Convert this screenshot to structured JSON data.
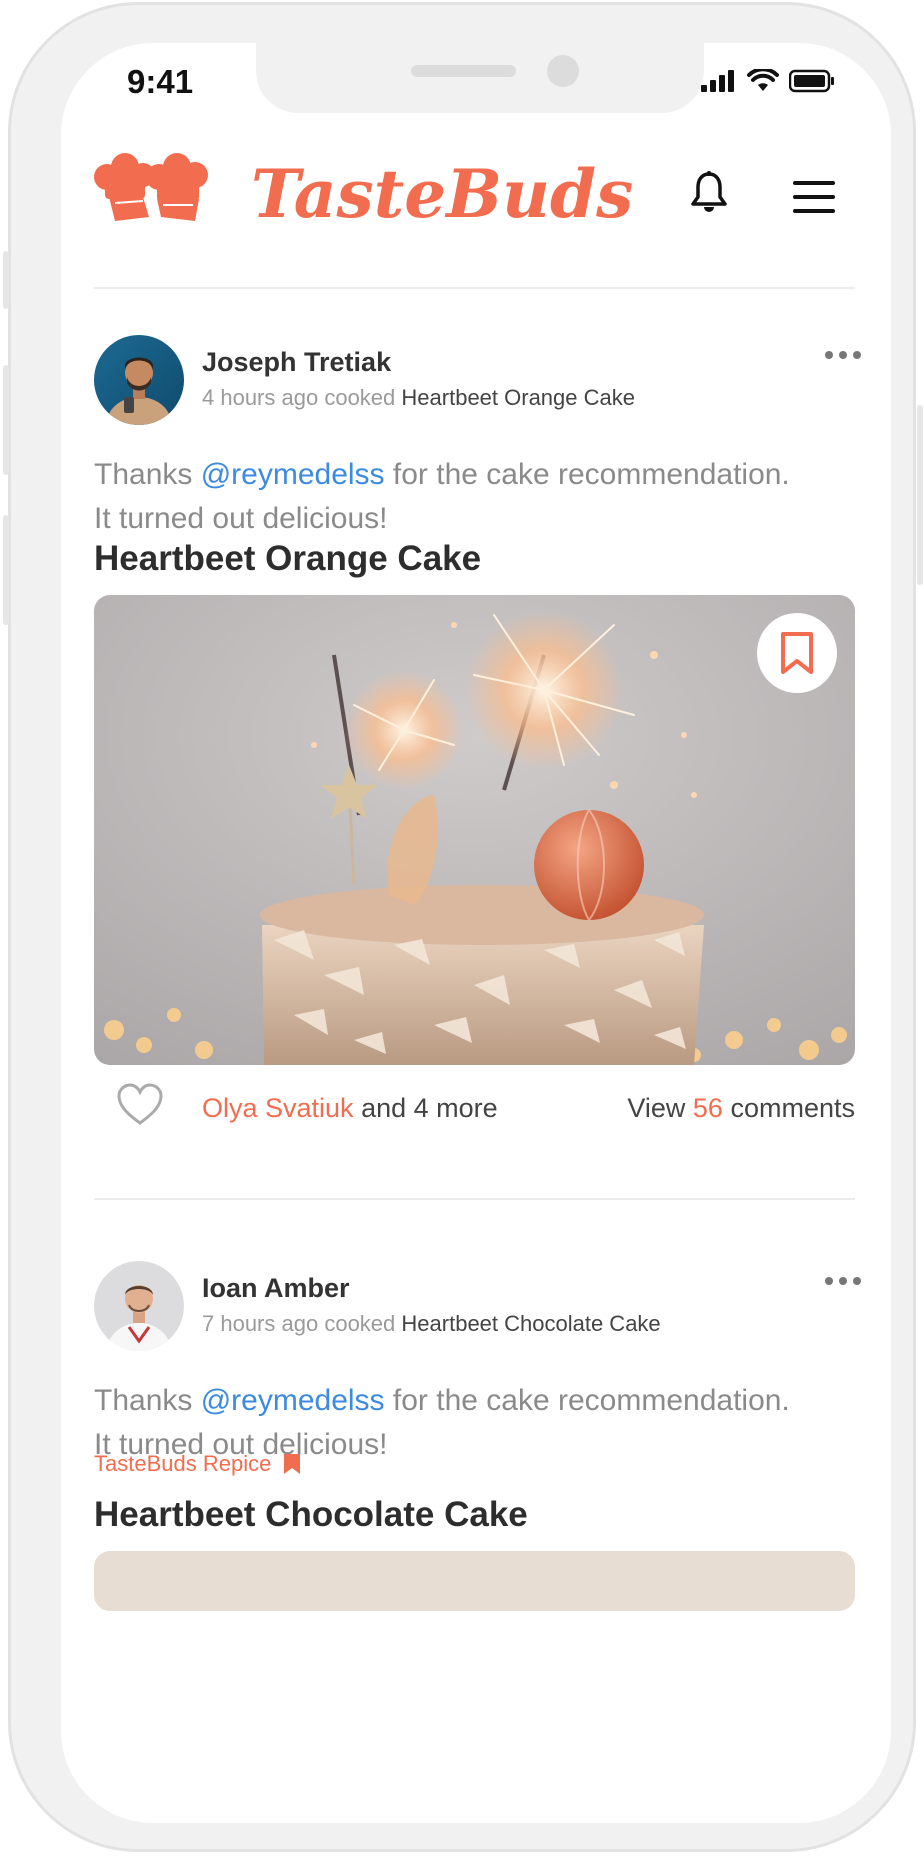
{
  "status_bar": {
    "time": "9:41"
  },
  "app": {
    "name": "TasteBuds",
    "brand_color": "#f26d4f",
    "mention_color": "#3c8be0"
  },
  "header": {
    "icons": [
      "chef-hat-logo-icon",
      "bell-icon",
      "hamburger-menu-icon"
    ]
  },
  "posts": [
    {
      "author": "Joseph Tretiak",
      "time_ago": "4 hours ago",
      "action": "cooked",
      "dish": "Heartbeet Orange Cake",
      "text_before": "Thanks ",
      "mention": "@reymedelss",
      "text_after": " for the cake recommendation. It turned out delicious!",
      "recipe_title": "Heartbeet Orange Cake",
      "liked_by": "Olya Svatiuk",
      "likes_more": "and 4 more",
      "comments_prefix": "View",
      "comments_count": "56",
      "comments_suffix": "comments"
    },
    {
      "author": "Ioan Amber",
      "time_ago": "7 hours ago",
      "action": "cooked",
      "dish": "Heartbeet Chocolate Cake",
      "text_before": "Thanks ",
      "mention": "@reymedelss",
      "text_after": " for the cake recommendation. It turned out delicious!",
      "tag": "TasteBuds Repice",
      "recipe_title": "Heartbeet Chocolate Cake"
    }
  ]
}
